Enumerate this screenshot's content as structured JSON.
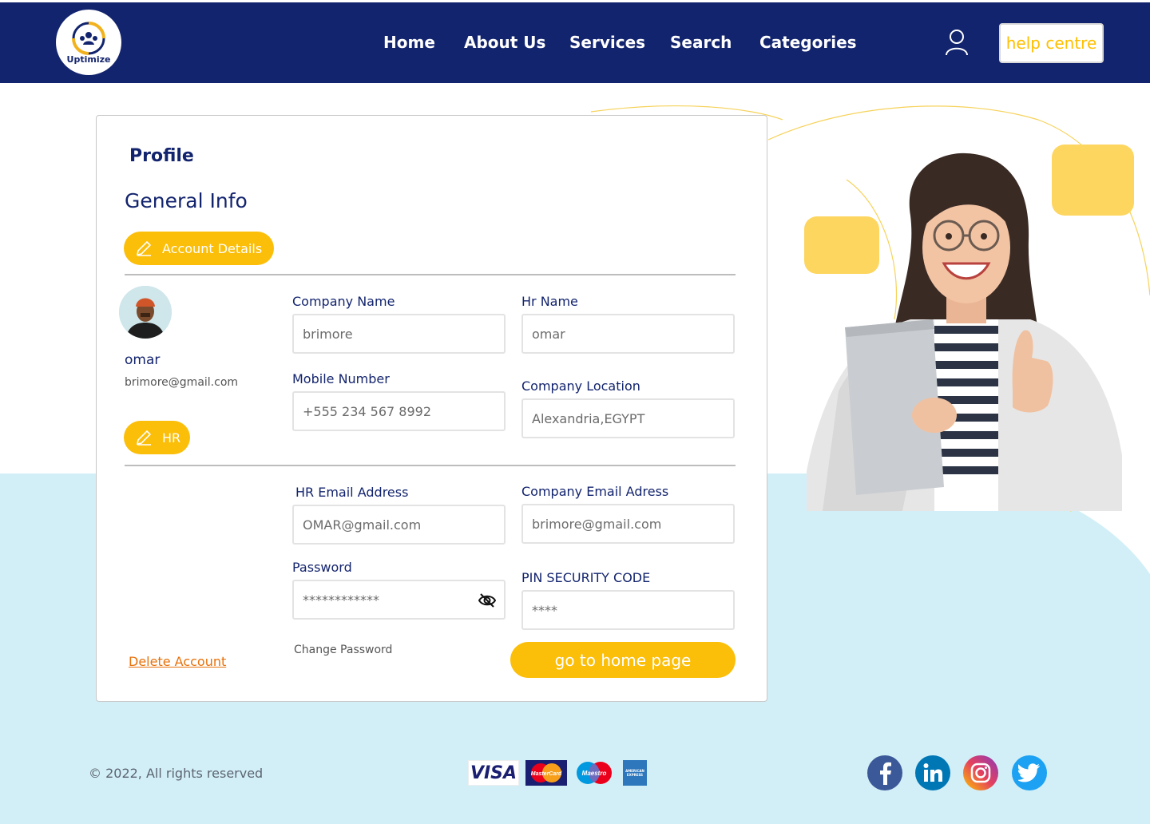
{
  "brand": {
    "logo_text": "Uptimize"
  },
  "nav": {
    "items": [
      {
        "label": "Home"
      },
      {
        "label": "About Us"
      },
      {
        "label": "Services"
      },
      {
        "label": "Search"
      },
      {
        "label": "Categories"
      }
    ],
    "help_label": "help centre"
  },
  "profile": {
    "title": "Profile",
    "section_title": "General Info",
    "account_details_label": "Account Details",
    "role_label": "HR",
    "user_name": "omar",
    "user_email": "brimore@gmail.com"
  },
  "form": {
    "company_name": {
      "label": "Company Name",
      "value": "brimore"
    },
    "hr_name": {
      "label": "Hr Name",
      "value": "omar"
    },
    "mobile": {
      "label": "Mobile Number",
      "value": "+555 234 567 8992"
    },
    "company_location": {
      "label": "Company Location",
      "value": "Alexandria,EGYPT"
    },
    "hr_email": {
      "label": "HR Email Address",
      "value": "OMAR@gmail.com"
    },
    "company_email": {
      "label": "Company Email Adress",
      "value": "brimore@gmail.com"
    },
    "password": {
      "label": "Password",
      "value": "************"
    },
    "pin": {
      "label": "PIN SECURITY CODE",
      "value": "****"
    }
  },
  "actions": {
    "delete_account": "Delete Account",
    "change_password": "Change Password",
    "go_home": "go to home page"
  },
  "footer": {
    "copyright": "© 2022, All rights reserved",
    "payment_methods": [
      "VISA",
      "MasterCard",
      "Maestro",
      "AMERICAN EXPRESS"
    ],
    "social_icons": [
      "facebook-icon",
      "linkedin-icon",
      "instagram-icon",
      "twitter-icon"
    ]
  },
  "colors": {
    "header": "#13246e",
    "accent": "#fbbe09",
    "band": "#d2eff7",
    "delete": "#e8710a"
  }
}
